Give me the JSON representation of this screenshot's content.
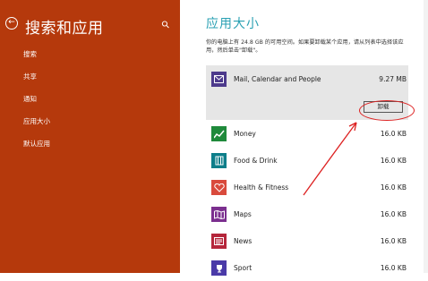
{
  "sidebar": {
    "title": "搜索和应用",
    "back_icon": "back-arrow-icon",
    "search_icon": "search-icon",
    "items": [
      {
        "label": "搜索"
      },
      {
        "label": "共享"
      },
      {
        "label": "通知"
      },
      {
        "label": "应用大小"
      },
      {
        "label": "默认应用"
      }
    ],
    "color": "#b5390c"
  },
  "main": {
    "title": "应用大小",
    "description": "你的电脑上有 24.8 GB 的可用空间。如果要卸载某个应用，请从列表中选择该应用，然后单击\"卸载\"。",
    "title_color": "#2aa0b3",
    "apps": [
      {
        "name": "Mail, Calendar and People",
        "size": "9.27 MB",
        "icon": "mail-calendar-people-icon",
        "icon_color": "#4d3a8c",
        "selected": true
      },
      {
        "name": "Money",
        "size": "16.0 KB",
        "icon": "money-chart-icon",
        "icon_color": "#1f8a3b"
      },
      {
        "name": "Food & Drink",
        "size": "16.0 KB",
        "icon": "food-drink-icon",
        "icon_color": "#0d7e8a"
      },
      {
        "name": "Health & Fitness",
        "size": "16.0 KB",
        "icon": "health-heart-icon",
        "icon_color": "#d94a3c"
      },
      {
        "name": "Maps",
        "size": "16.0 KB",
        "icon": "maps-icon",
        "icon_color": "#7b2f8f"
      },
      {
        "name": "News",
        "size": "16.0 KB",
        "icon": "news-icon",
        "icon_color": "#b5263b"
      },
      {
        "name": "Sport",
        "size": "16.0 KB",
        "icon": "sport-trophy-icon",
        "icon_color": "#4a3aa8"
      }
    ],
    "uninstall_label": "卸载"
  }
}
